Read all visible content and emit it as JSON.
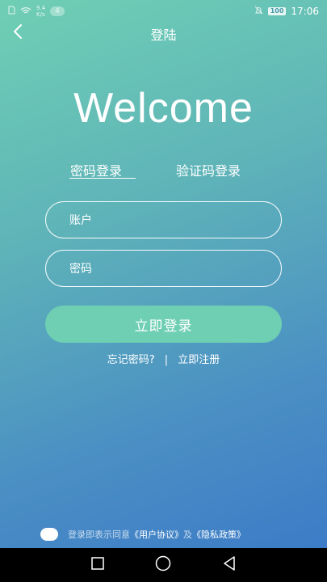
{
  "status_bar": {
    "net_speed_value": "9.4",
    "net_speed_unit": "K/s",
    "notification_count": "4",
    "battery": "100",
    "time": "17:06"
  },
  "header": {
    "title": "登陆"
  },
  "welcome": "Welcome",
  "tabs": [
    {
      "label": "密码登录",
      "active": true
    },
    {
      "label": "验证码登录",
      "active": false
    }
  ],
  "form": {
    "account_placeholder": "账户",
    "password_placeholder": "密码",
    "login_label": "立即登录"
  },
  "links": {
    "forgot": "忘记密码?",
    "divider": "|",
    "register": "立即注册"
  },
  "agreement": {
    "prefix": "登录即表示同意",
    "user_agreement": "《用户协议》",
    "and": "及",
    "privacy_policy": "《隐私政策》"
  },
  "colors": {
    "gradient_top": "#6fcfb4",
    "gradient_bottom": "#3a78c8",
    "button": "#6ecfb2"
  },
  "icons": {
    "back": "chevron-left-icon",
    "nav_recent": "square-icon",
    "nav_home": "circle-icon",
    "nav_back": "triangle-icon"
  }
}
